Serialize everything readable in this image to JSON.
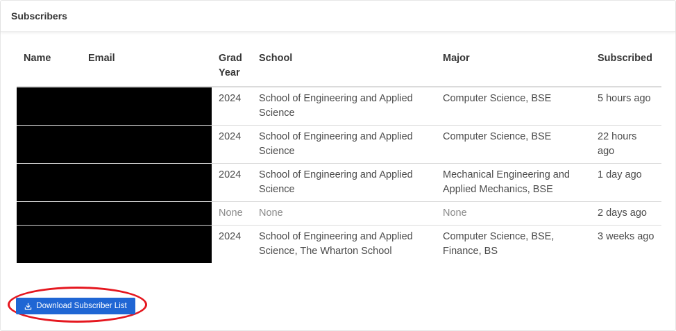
{
  "card": {
    "title": "Subscribers"
  },
  "table": {
    "headers": {
      "name": "Name",
      "email": "Email",
      "grad_year": "Grad Year",
      "school": "School",
      "major": "Major",
      "subscribed": "Subscribed"
    },
    "rows": [
      {
        "grad_year": "2024",
        "school": "School of Engineering and Applied Science",
        "major": "Computer Science, BSE",
        "subscribed": "5 hours ago"
      },
      {
        "grad_year": "2024",
        "school": "School of Engineering and Applied Science",
        "major": "Computer Science, BSE",
        "subscribed": "22 hours ago"
      },
      {
        "grad_year": "2024",
        "school": "School of Engineering and Applied Science",
        "major": "Mechanical Engineering and Applied Mechanics, BSE",
        "subscribed": "1 day ago"
      },
      {
        "grad_year": "None",
        "school": "None",
        "major": "None",
        "subscribed": "2 days ago"
      },
      {
        "grad_year": "2024",
        "school": "School of Engineering and Applied Science, The Wharton School",
        "major": "Computer Science, BSE, Finance, BS",
        "subscribed": "3 weeks ago"
      }
    ]
  },
  "download_button": {
    "label": "Download Subscriber List",
    "icon": "download-icon"
  },
  "colors": {
    "button": "#1f66d4",
    "highlight_ring": "#e5171f",
    "redaction": "#000000"
  }
}
